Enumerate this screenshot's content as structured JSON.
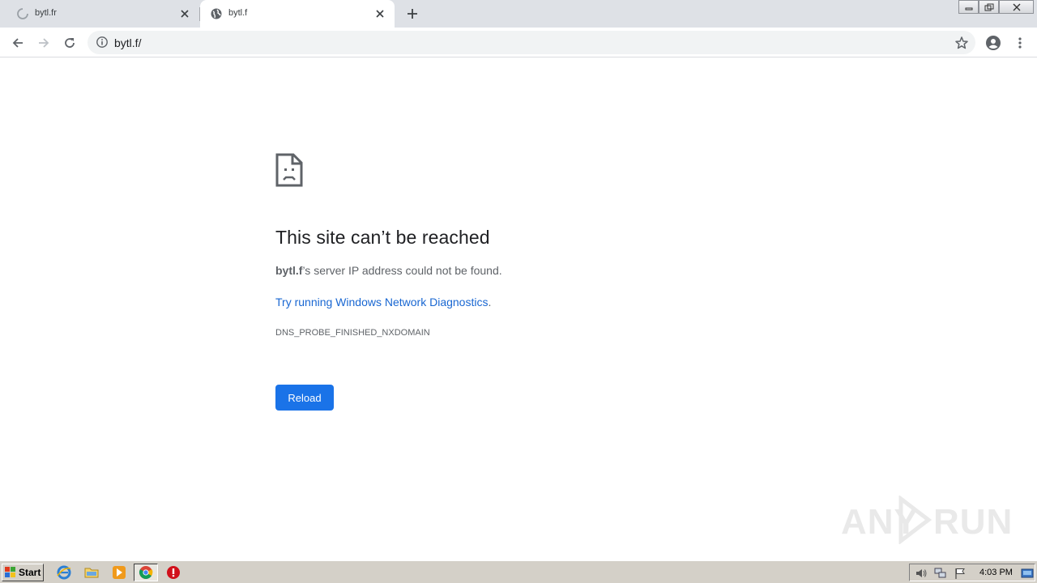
{
  "browser": {
    "tabs": [
      {
        "title": "bytl.fr",
        "state": "loading"
      },
      {
        "title": "bytl.f",
        "state": "active"
      }
    ],
    "url": "bytl.f/"
  },
  "error": {
    "title": "This site can’t be reached",
    "host": "bytl.f",
    "desc_suffix": "’s server IP address could not be found.",
    "link_text": "Try running Windows Network Diagnostics",
    "link_suffix": ".",
    "code": "DNS_PROBE_FINISHED_NXDOMAIN",
    "reload_label": "Reload"
  },
  "watermark": {
    "left": "ANY",
    "right": "RUN"
  },
  "taskbar": {
    "start_label": "Start",
    "clock": "4:03 PM",
    "apps": [
      "ie-icon",
      "folder-icon",
      "media-player-icon",
      "chrome-icon",
      "opera-icon"
    ]
  },
  "colors": {
    "accent": "#1a73e8",
    "link": "#1967d2",
    "tabstrip": "#dee1e6"
  }
}
